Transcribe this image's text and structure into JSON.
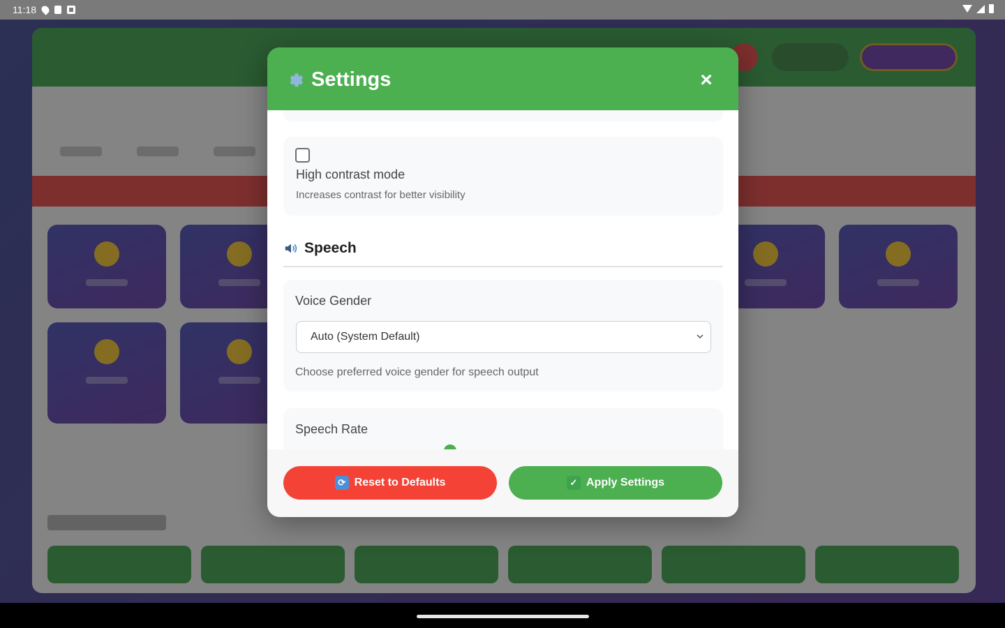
{
  "status_bar": {
    "time": "11:18"
  },
  "modal": {
    "title": "Settings",
    "close_label": "×",
    "high_contrast": {
      "label": "High contrast mode",
      "description": "Increases contrast for better visibility",
      "checked": false
    },
    "speech_section": {
      "title": "Speech",
      "voice_gender": {
        "label": "Voice Gender",
        "selected": "Auto (System Default)",
        "help": "Choose preferred voice gender for speech output"
      },
      "speech_rate": {
        "label": "Speech Rate"
      }
    },
    "footer": {
      "reset_label": "Reset to Defaults",
      "apply_label": "Apply Settings"
    }
  },
  "colors": {
    "header_green": "#4caf50",
    "reset_red": "#f44336",
    "apply_green": "#4caf50",
    "app_gradient_start": "#2f3a8a",
    "app_gradient_end": "#4b2a8c"
  }
}
